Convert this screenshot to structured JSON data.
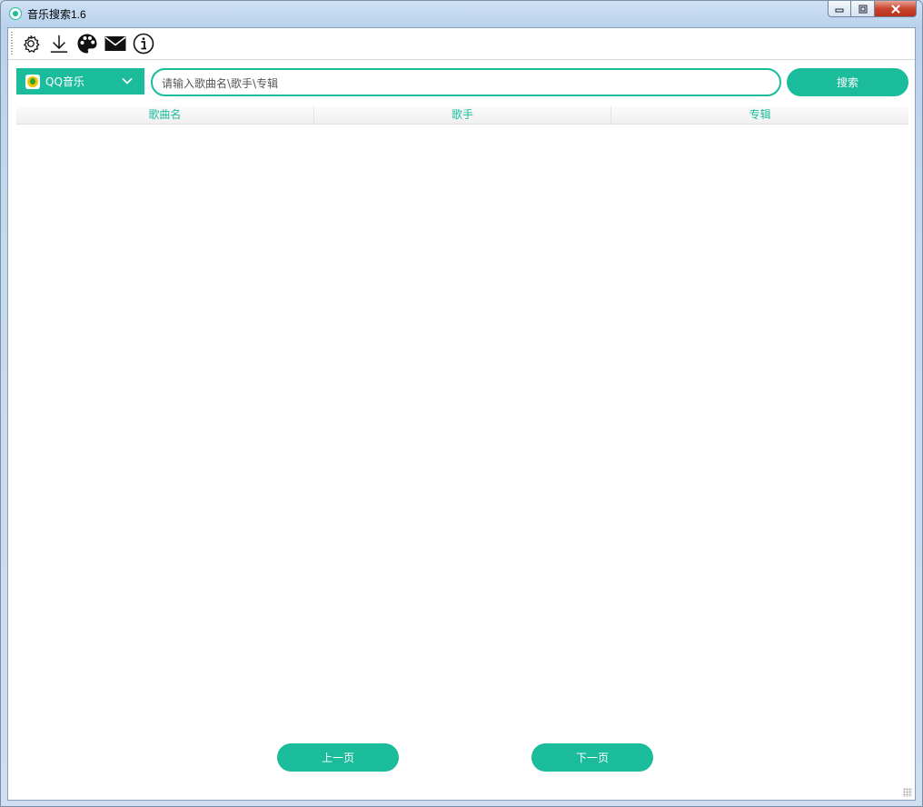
{
  "window": {
    "title": "音乐搜索1.6",
    "min_glyph": "▭",
    "max_glyph": "◻",
    "close_glyph": "✕"
  },
  "toolbar": {
    "items": [
      {
        "icon": "gear-icon"
      },
      {
        "icon": "download-icon"
      },
      {
        "icon": "palette-icon"
      },
      {
        "icon": "mail-icon"
      },
      {
        "icon": "info-icon"
      }
    ]
  },
  "search": {
    "source_label": "QQ音乐",
    "placeholder": "请输入歌曲名\\歌手\\专辑",
    "value": "",
    "button_label": "搜索"
  },
  "table": {
    "columns": [
      "歌曲名",
      "歌手",
      "专辑"
    ],
    "rows": []
  },
  "pagination": {
    "prev_label": "上一页",
    "next_label": "下一页"
  },
  "colors": {
    "accent": "#1bbc9b"
  }
}
